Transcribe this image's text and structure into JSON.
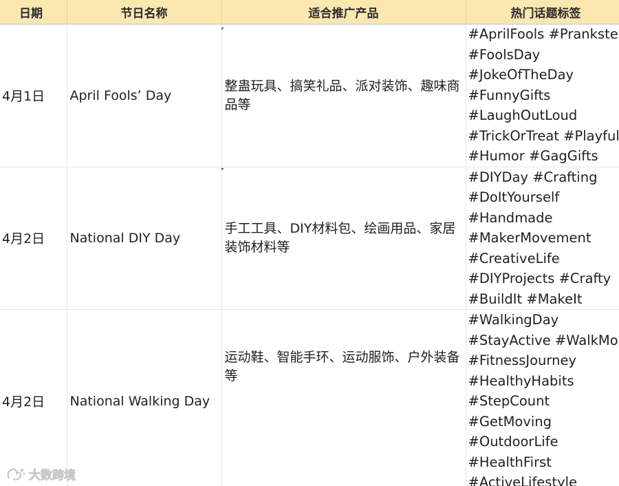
{
  "headers": [
    "日期",
    "节日名称",
    "适合推广产品",
    "热门话题标签"
  ],
  "rows": [
    {
      "date": "4月1日",
      "name": "April Fools’ Day",
      "products": "整蛊玩具、搞笑礼品、派对装饰、趣味商品等",
      "tags": [
        "#AprilFools #Prankster",
        "#FoolsDay",
        "#JokeOfTheDay",
        "#FunnyGifts",
        "#LaughOutLoud",
        "#TrickOrTreat #Playful",
        "#Humor #GagGifts"
      ]
    },
    {
      "date": "4月2日",
      "name": "National DIY Day",
      "products": "手工工具、DIY材料包、绘画用品、家居装饰材料等",
      "tags": [
        "#DIYDay #Crafting",
        "#DoItYourself",
        "#Handmade",
        "#MakerMovement",
        "#CreativeLife",
        "#DIYProjects #Crafty",
        "#BuildIt #MakeIt"
      ]
    },
    {
      "date": "4月2日",
      "name": "National Walking Day",
      "products": "运动鞋、智能手环、运动服饰、户外装备等",
      "tags": [
        "#WalkingDay",
        "#StayActive #WalkMore",
        "#FitnessJourney",
        "#HealthyHabits",
        "#StepCount",
        "#GetMoving",
        "#OutdoorLife",
        "#HealthFirst",
        "#ActiveLifestyle"
      ]
    }
  ],
  "watermark": {
    "text": "大数跨境",
    "icon": "logo-icon"
  },
  "colors": {
    "header_bg": "#fbe7b0",
    "grid": "#e6e6e6",
    "cell_marker": "#2e8b3a"
  }
}
